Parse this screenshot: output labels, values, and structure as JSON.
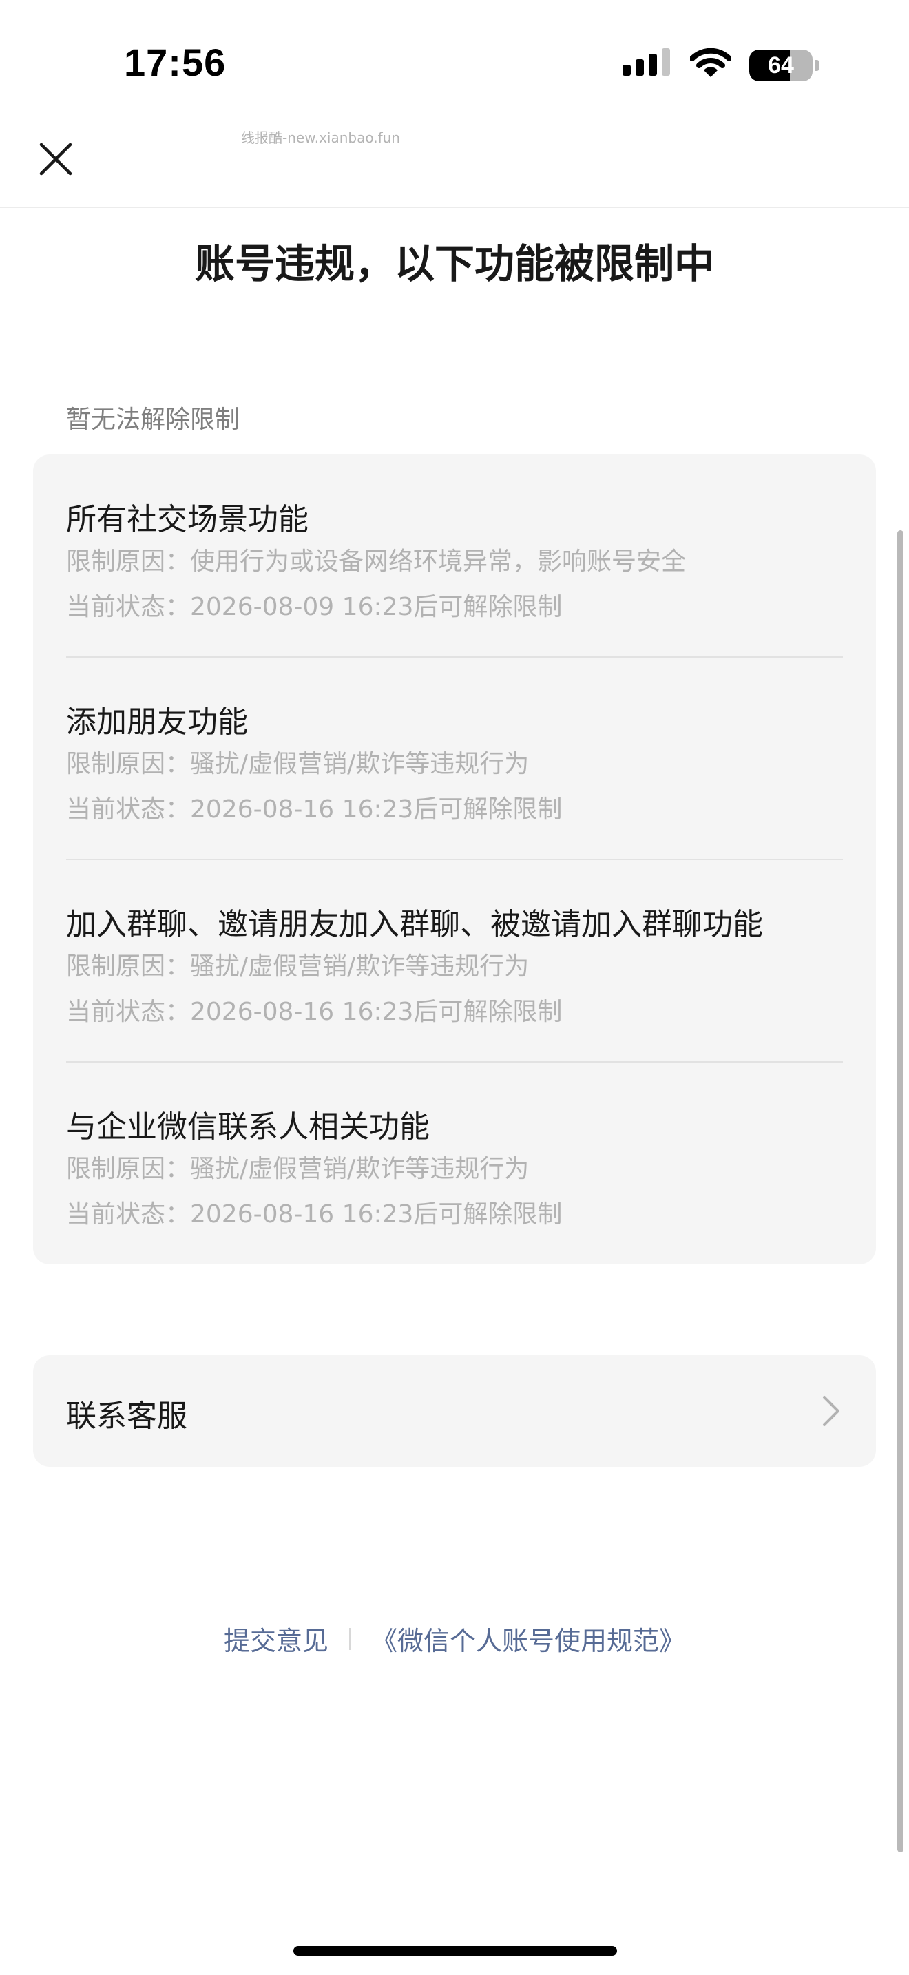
{
  "status_bar": {
    "time": "17:56",
    "battery_level": "64",
    "battery_fraction": 0.64,
    "signal_icon": "cellular-signal-icon",
    "wifi_icon": "wifi-icon"
  },
  "header": {
    "close_icon": "close-icon",
    "watermark": "线报酷-new.xianbao.fun"
  },
  "title": "账号违规，以下功能被限制中",
  "section_label": "暂无法解除限制",
  "restrictions": [
    {
      "title": "所有社交场景功能",
      "reason": "限制原因：使用行为或设备网络环境异常，影响账号安全",
      "status": "当前状态：2026-08-09 16:23后可解除限制"
    },
    {
      "title": "添加朋友功能",
      "reason": "限制原因：骚扰/虚假营销/欺诈等违规行为",
      "status": "当前状态：2026-08-16 16:23后可解除限制"
    },
    {
      "title": "加入群聊、邀请朋友加入群聊、被邀请加入群聊功能",
      "reason": "限制原因：骚扰/虚假营销/欺诈等违规行为",
      "status": "当前状态：2026-08-16 16:23后可解除限制"
    },
    {
      "title": "与企业微信联系人相关功能",
      "reason": "限制原因：骚扰/虚假营销/欺诈等违规行为",
      "status": "当前状态：2026-08-16 16:23后可解除限制"
    }
  ],
  "contact": {
    "label": "联系客服",
    "chevron_icon": "chevron-right-icon"
  },
  "footer": {
    "feedback": "提交意见",
    "policy": "《微信个人账号使用规范》"
  },
  "colors": {
    "link": "#576b95",
    "card_bg": "#f5f5f5",
    "secondary_text": "#b2b2b2"
  }
}
